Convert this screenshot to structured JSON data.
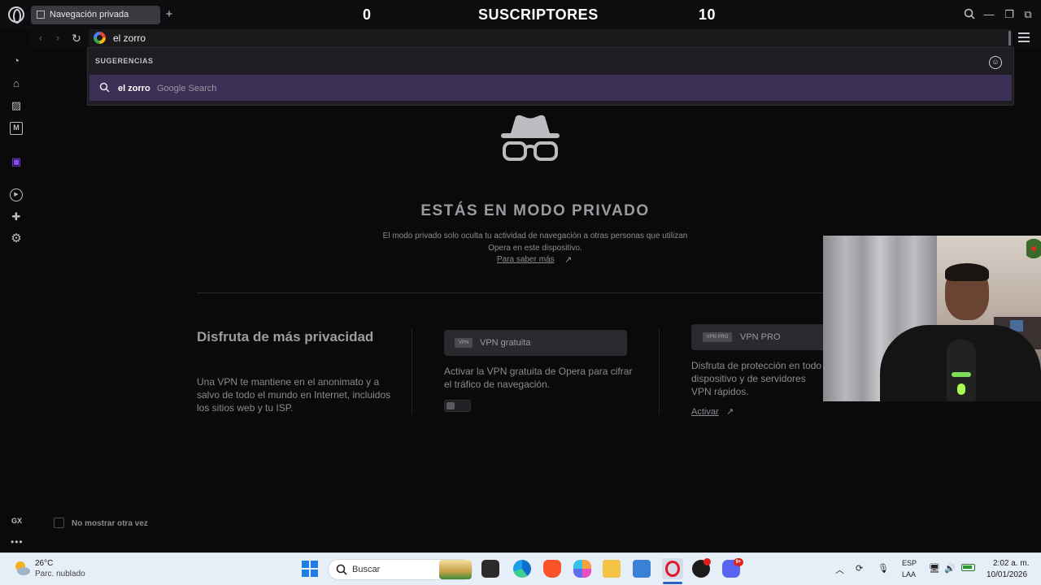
{
  "browser": {
    "tab_label": "Navegación privada",
    "new_tab": "+",
    "address_value": "el zorro"
  },
  "overlay": {
    "left_count": "0",
    "title": "SUSCRIPTORES",
    "right_count": "10"
  },
  "window_controls": {
    "minimize": "—",
    "maximize": "❐",
    "close": "⧉"
  },
  "nav": {
    "back": "‹",
    "forward": "›",
    "reload": "↻"
  },
  "dropdown": {
    "header": "SUGERENCIAS",
    "suggestion_query": "el zorro",
    "suggestion_separator": "-",
    "suggestion_source": "Google Search"
  },
  "sidebar": {
    "items": [
      {
        "icon": "speed-dial-icon",
        "glyph": "◔"
      },
      {
        "icon": "shopping-icon",
        "glyph": "⌂"
      },
      {
        "icon": "wallpaper-icon",
        "glyph": "▨"
      },
      {
        "icon": "messenger-icon",
        "glyph": "M"
      },
      {
        "icon": "twitch-icon",
        "glyph": "▣"
      },
      {
        "icon": "player-icon",
        "glyph": "▶"
      },
      {
        "icon": "extensions-icon",
        "glyph": "✚"
      },
      {
        "icon": "settings-icon",
        "glyph": "⚙"
      }
    ],
    "gx_label": "GX",
    "more": "•••"
  },
  "private_page": {
    "title": "ESTÁS EN MODO PRIVADO",
    "description": "El modo privado solo oculta tu actividad de navegación a otras personas que utilizan Opera en este dispositivo.",
    "learn_more": "Para saber más",
    "arrow": "↗"
  },
  "promo": {
    "title": "Disfruta de más privacidad",
    "description": "Una VPN te mantiene en el anonimato y a salvo de todo el mundo en Internet, incluidos los sitios web y tu ISP.",
    "vpn": {
      "badge": "VPN",
      "label": "VPN gratuita",
      "description": "Activar la VPN gratuita de Opera para cifrar el tráfico de navegación.",
      "enabled": false
    },
    "vpn_pro": {
      "badge": "VPN PRO",
      "label": "VPN PRO",
      "description": "Disfruta de protección en todo dispositivo y de servidores VPN rápidos.",
      "activate": "Activar",
      "arrow": "↗"
    },
    "dont_show": "No mostrar otra vez"
  },
  "taskbar": {
    "weather_temp": "26°C",
    "weather_desc": "Parc. nublado",
    "search_label": "Buscar",
    "discord_badge": "9+",
    "lang_1": "ESP",
    "lang_2": "LAA",
    "time": "2:02 a. m.",
    "date": "10/01/2026",
    "tray": {
      "caret": "︿",
      "sync": "⟳",
      "mic": "🎙",
      "network": "🖥",
      "volume": "🔊"
    }
  }
}
